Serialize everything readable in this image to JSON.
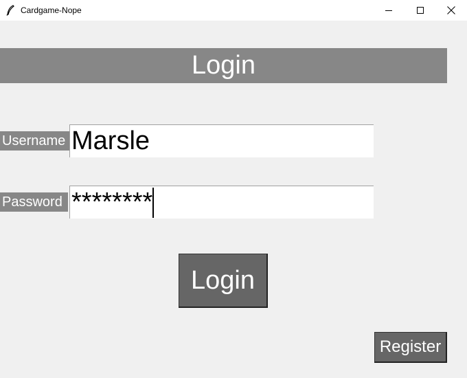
{
  "window": {
    "title": "Cardgame-Nope",
    "icon": "feather-icon",
    "controls": [
      "minimize-icon",
      "maximize-icon",
      "close-icon"
    ]
  },
  "header": {
    "title": "Login"
  },
  "form": {
    "username_label": "Username",
    "username_value": "Marsle",
    "password_label": "Password",
    "password_value": "********"
  },
  "buttons": {
    "login_label": "Login",
    "register_label": "Register"
  },
  "colors": {
    "background": "#f0f0f0",
    "header_bar": "#878787",
    "label_bg": "#878787",
    "button_bg": "#666666",
    "text_light": "#ffffff"
  }
}
